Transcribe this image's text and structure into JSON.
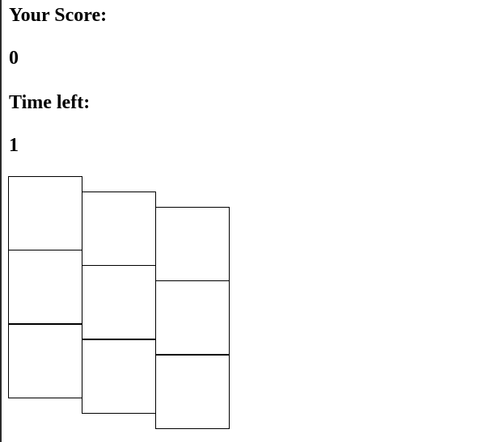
{
  "score_label": "Your Score:",
  "score_value": "0",
  "time_label": "Time left:",
  "time_value": "1",
  "grid": {
    "columns": 3,
    "rows": 3
  }
}
